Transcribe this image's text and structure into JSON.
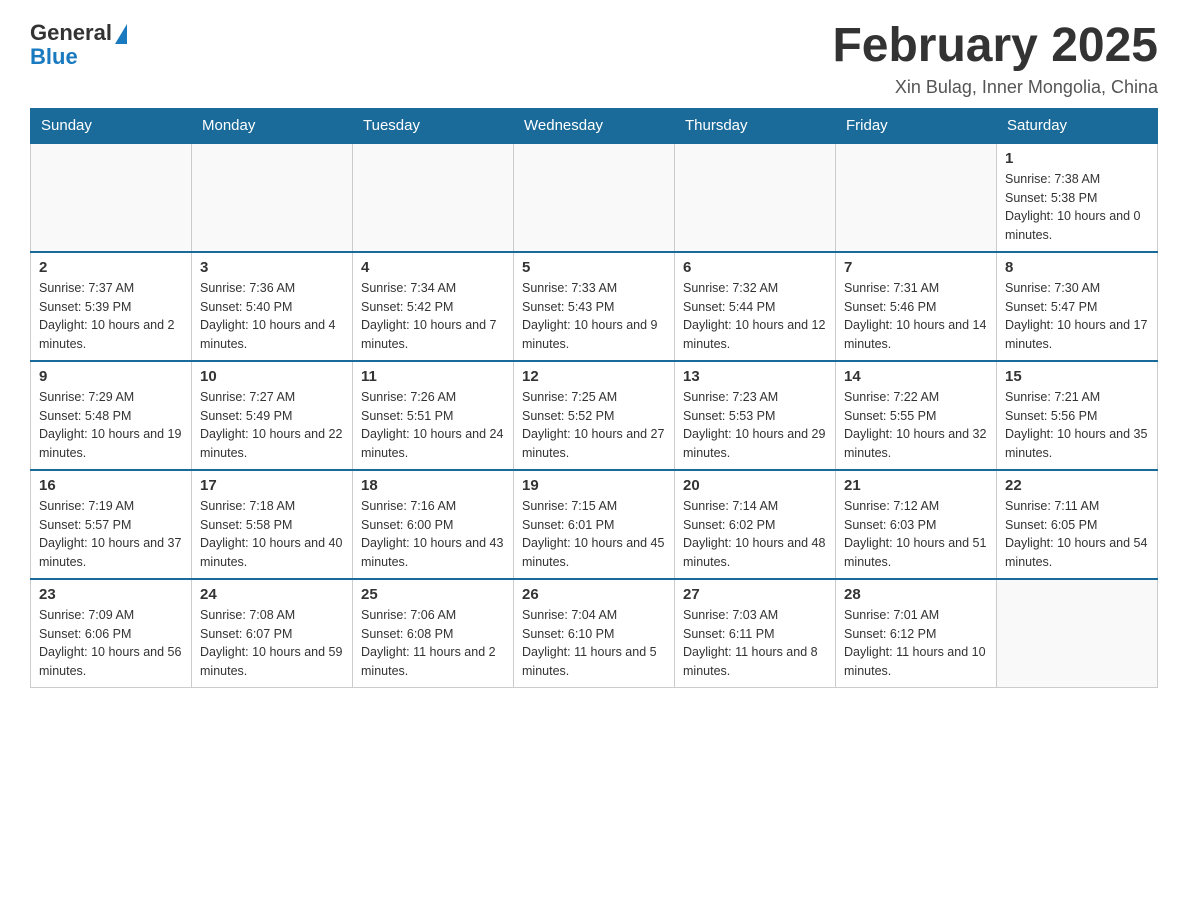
{
  "logo": {
    "general": "General",
    "blue": "Blue"
  },
  "header": {
    "title": "February 2025",
    "location": "Xin Bulag, Inner Mongolia, China"
  },
  "days_of_week": [
    "Sunday",
    "Monday",
    "Tuesday",
    "Wednesday",
    "Thursday",
    "Friday",
    "Saturday"
  ],
  "weeks": [
    [
      {
        "day": "",
        "info": ""
      },
      {
        "day": "",
        "info": ""
      },
      {
        "day": "",
        "info": ""
      },
      {
        "day": "",
        "info": ""
      },
      {
        "day": "",
        "info": ""
      },
      {
        "day": "",
        "info": ""
      },
      {
        "day": "1",
        "info": "Sunrise: 7:38 AM\nSunset: 5:38 PM\nDaylight: 10 hours and 0 minutes."
      }
    ],
    [
      {
        "day": "2",
        "info": "Sunrise: 7:37 AM\nSunset: 5:39 PM\nDaylight: 10 hours and 2 minutes."
      },
      {
        "day": "3",
        "info": "Sunrise: 7:36 AM\nSunset: 5:40 PM\nDaylight: 10 hours and 4 minutes."
      },
      {
        "day": "4",
        "info": "Sunrise: 7:34 AM\nSunset: 5:42 PM\nDaylight: 10 hours and 7 minutes."
      },
      {
        "day": "5",
        "info": "Sunrise: 7:33 AM\nSunset: 5:43 PM\nDaylight: 10 hours and 9 minutes."
      },
      {
        "day": "6",
        "info": "Sunrise: 7:32 AM\nSunset: 5:44 PM\nDaylight: 10 hours and 12 minutes."
      },
      {
        "day": "7",
        "info": "Sunrise: 7:31 AM\nSunset: 5:46 PM\nDaylight: 10 hours and 14 minutes."
      },
      {
        "day": "8",
        "info": "Sunrise: 7:30 AM\nSunset: 5:47 PM\nDaylight: 10 hours and 17 minutes."
      }
    ],
    [
      {
        "day": "9",
        "info": "Sunrise: 7:29 AM\nSunset: 5:48 PM\nDaylight: 10 hours and 19 minutes."
      },
      {
        "day": "10",
        "info": "Sunrise: 7:27 AM\nSunset: 5:49 PM\nDaylight: 10 hours and 22 minutes."
      },
      {
        "day": "11",
        "info": "Sunrise: 7:26 AM\nSunset: 5:51 PM\nDaylight: 10 hours and 24 minutes."
      },
      {
        "day": "12",
        "info": "Sunrise: 7:25 AM\nSunset: 5:52 PM\nDaylight: 10 hours and 27 minutes."
      },
      {
        "day": "13",
        "info": "Sunrise: 7:23 AM\nSunset: 5:53 PM\nDaylight: 10 hours and 29 minutes."
      },
      {
        "day": "14",
        "info": "Sunrise: 7:22 AM\nSunset: 5:55 PM\nDaylight: 10 hours and 32 minutes."
      },
      {
        "day": "15",
        "info": "Sunrise: 7:21 AM\nSunset: 5:56 PM\nDaylight: 10 hours and 35 minutes."
      }
    ],
    [
      {
        "day": "16",
        "info": "Sunrise: 7:19 AM\nSunset: 5:57 PM\nDaylight: 10 hours and 37 minutes."
      },
      {
        "day": "17",
        "info": "Sunrise: 7:18 AM\nSunset: 5:58 PM\nDaylight: 10 hours and 40 minutes."
      },
      {
        "day": "18",
        "info": "Sunrise: 7:16 AM\nSunset: 6:00 PM\nDaylight: 10 hours and 43 minutes."
      },
      {
        "day": "19",
        "info": "Sunrise: 7:15 AM\nSunset: 6:01 PM\nDaylight: 10 hours and 45 minutes."
      },
      {
        "day": "20",
        "info": "Sunrise: 7:14 AM\nSunset: 6:02 PM\nDaylight: 10 hours and 48 minutes."
      },
      {
        "day": "21",
        "info": "Sunrise: 7:12 AM\nSunset: 6:03 PM\nDaylight: 10 hours and 51 minutes."
      },
      {
        "day": "22",
        "info": "Sunrise: 7:11 AM\nSunset: 6:05 PM\nDaylight: 10 hours and 54 minutes."
      }
    ],
    [
      {
        "day": "23",
        "info": "Sunrise: 7:09 AM\nSunset: 6:06 PM\nDaylight: 10 hours and 56 minutes."
      },
      {
        "day": "24",
        "info": "Sunrise: 7:08 AM\nSunset: 6:07 PM\nDaylight: 10 hours and 59 minutes."
      },
      {
        "day": "25",
        "info": "Sunrise: 7:06 AM\nSunset: 6:08 PM\nDaylight: 11 hours and 2 minutes."
      },
      {
        "day": "26",
        "info": "Sunrise: 7:04 AM\nSunset: 6:10 PM\nDaylight: 11 hours and 5 minutes."
      },
      {
        "day": "27",
        "info": "Sunrise: 7:03 AM\nSunset: 6:11 PM\nDaylight: 11 hours and 8 minutes."
      },
      {
        "day": "28",
        "info": "Sunrise: 7:01 AM\nSunset: 6:12 PM\nDaylight: 11 hours and 10 minutes."
      },
      {
        "day": "",
        "info": ""
      }
    ]
  ]
}
